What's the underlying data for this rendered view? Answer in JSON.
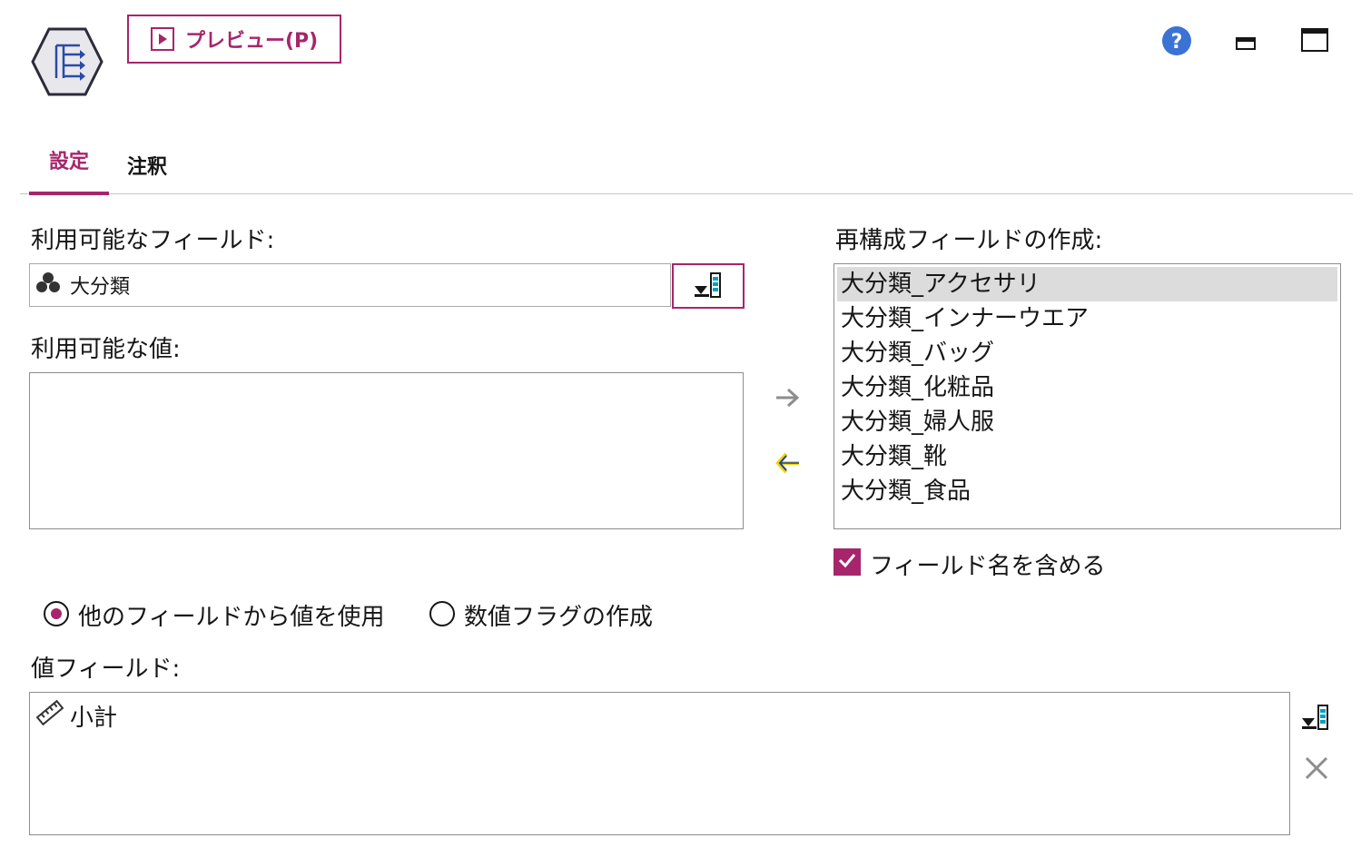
{
  "header": {
    "node_icon": "restructure-node-icon",
    "preview_label": "プレビュー(P)",
    "help_icon": "help-icon",
    "minimize_icon": "minimize-icon",
    "maximize_icon": "maximize-icon"
  },
  "tabs": [
    {
      "label": "設定",
      "active": true
    },
    {
      "label": "注釈",
      "active": false
    }
  ],
  "available_fields": {
    "label": "利用可能なフィールド:",
    "selected": "大分類",
    "type_icon": "set-type-icon"
  },
  "available_values": {
    "label": "利用可能な値:",
    "items": []
  },
  "generated_fields": {
    "label": "再構成フィールドの作成:",
    "items": [
      "大分類_アクセサリ",
      "大分類_インナーウエア",
      "大分類_バッグ",
      "大分類_化粧品",
      "大分類_婦人服",
      "大分類_靴",
      "大分類_食品"
    ],
    "selected_index": 0
  },
  "include_field_name": {
    "label": "フィールド名を含める",
    "checked": true
  },
  "mode": {
    "option_use_values": "他のフィールドから値を使用",
    "option_numeric_flags": "数値フラグの作成",
    "selected": "use_values"
  },
  "value_fields": {
    "label": "値フィールド:",
    "items": [
      {
        "name": "小計",
        "type_icon": "continuous-type-icon"
      }
    ]
  },
  "colors": {
    "accent": "#a7256b",
    "help_blue": "#3b73d4",
    "border": "#8d8d8d"
  }
}
